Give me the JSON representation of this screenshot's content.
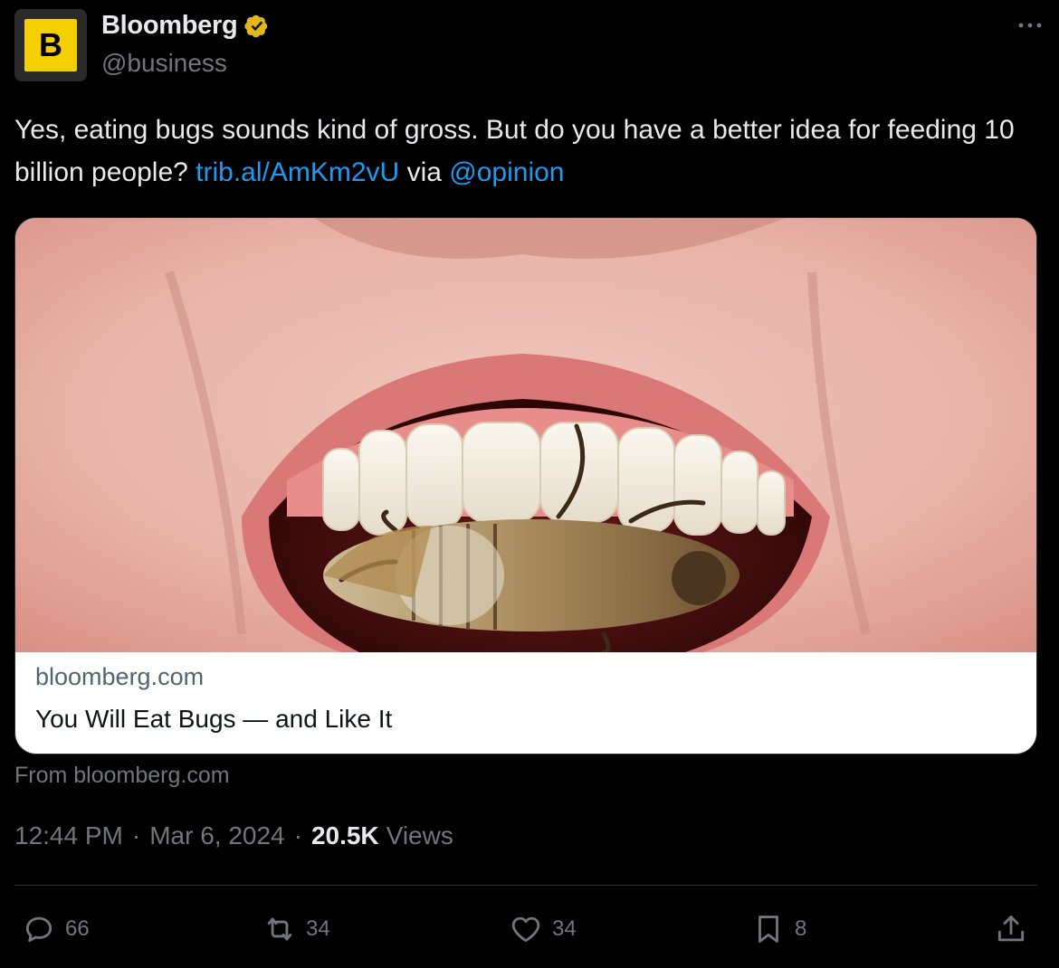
{
  "author": {
    "avatar_letter": "B",
    "display_name": "Bloomberg",
    "handle": "@business",
    "verified_icon": "verified-badge-icon",
    "brand_color": "#f5d000"
  },
  "tweet": {
    "text_before": "Yes, eating bugs sounds kind of gross. But do you have a better idea for feeding 10 billion people?",
    "link": "trib.al/AmKm2vU",
    "via": "via",
    "mention": "@opinion"
  },
  "card": {
    "image_icon": "mouth-with-beetle-photo",
    "domain": "bloomberg.com",
    "title": "You Will Eat Bugs — and Like It"
  },
  "from_label": "From bloomberg.com",
  "meta": {
    "time": "12:44 PM",
    "date": "Mar 6, 2024",
    "views_count": "20.5K",
    "views_label": "Views"
  },
  "actions": {
    "replies": "66",
    "reposts": "34",
    "likes": "34",
    "bookmarks": "8"
  },
  "colors": {
    "background": "#000000",
    "link": "#1d9bf0",
    "muted": "#71767b",
    "text": "#e7e9ea"
  }
}
